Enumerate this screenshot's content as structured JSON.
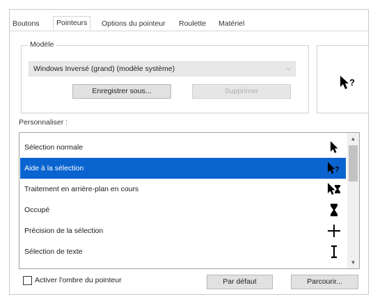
{
  "tabs": [
    "Boutons",
    "Pointeurs",
    "Options du pointeur",
    "Roulette",
    "Matériel"
  ],
  "active_tab_index": 1,
  "scheme": {
    "group_label": "Modèle",
    "selected": "Windows Inversé (grand) (modèle système)",
    "save_as_label": "Enregistrer sous...",
    "delete_label": "Supprimer"
  },
  "customize": {
    "label": "Personnaliser :",
    "items": [
      {
        "label": "Sélection normale",
        "icon": "arrow-cursor-icon"
      },
      {
        "label": "Aide à la sélection",
        "icon": "help-select-cursor-icon"
      },
      {
        "label": "Traitement en arrière-plan en cours",
        "icon": "working-background-cursor-icon"
      },
      {
        "label": "Occupé",
        "icon": "busy-hourglass-cursor-icon"
      },
      {
        "label": "Précision de la sélection",
        "icon": "precision-crosshair-cursor-icon"
      },
      {
        "label": "Sélection de texte",
        "icon": "text-beam-cursor-icon"
      }
    ],
    "selected_index": 1
  },
  "shadow": {
    "label": "Activer l'ombre du pointeur",
    "checked": false
  },
  "buttons": {
    "default": "Par défaut",
    "browse": "Parcourir..."
  },
  "colors": {
    "selection": "#0a64d0",
    "button_face": "#e1e1e1"
  }
}
